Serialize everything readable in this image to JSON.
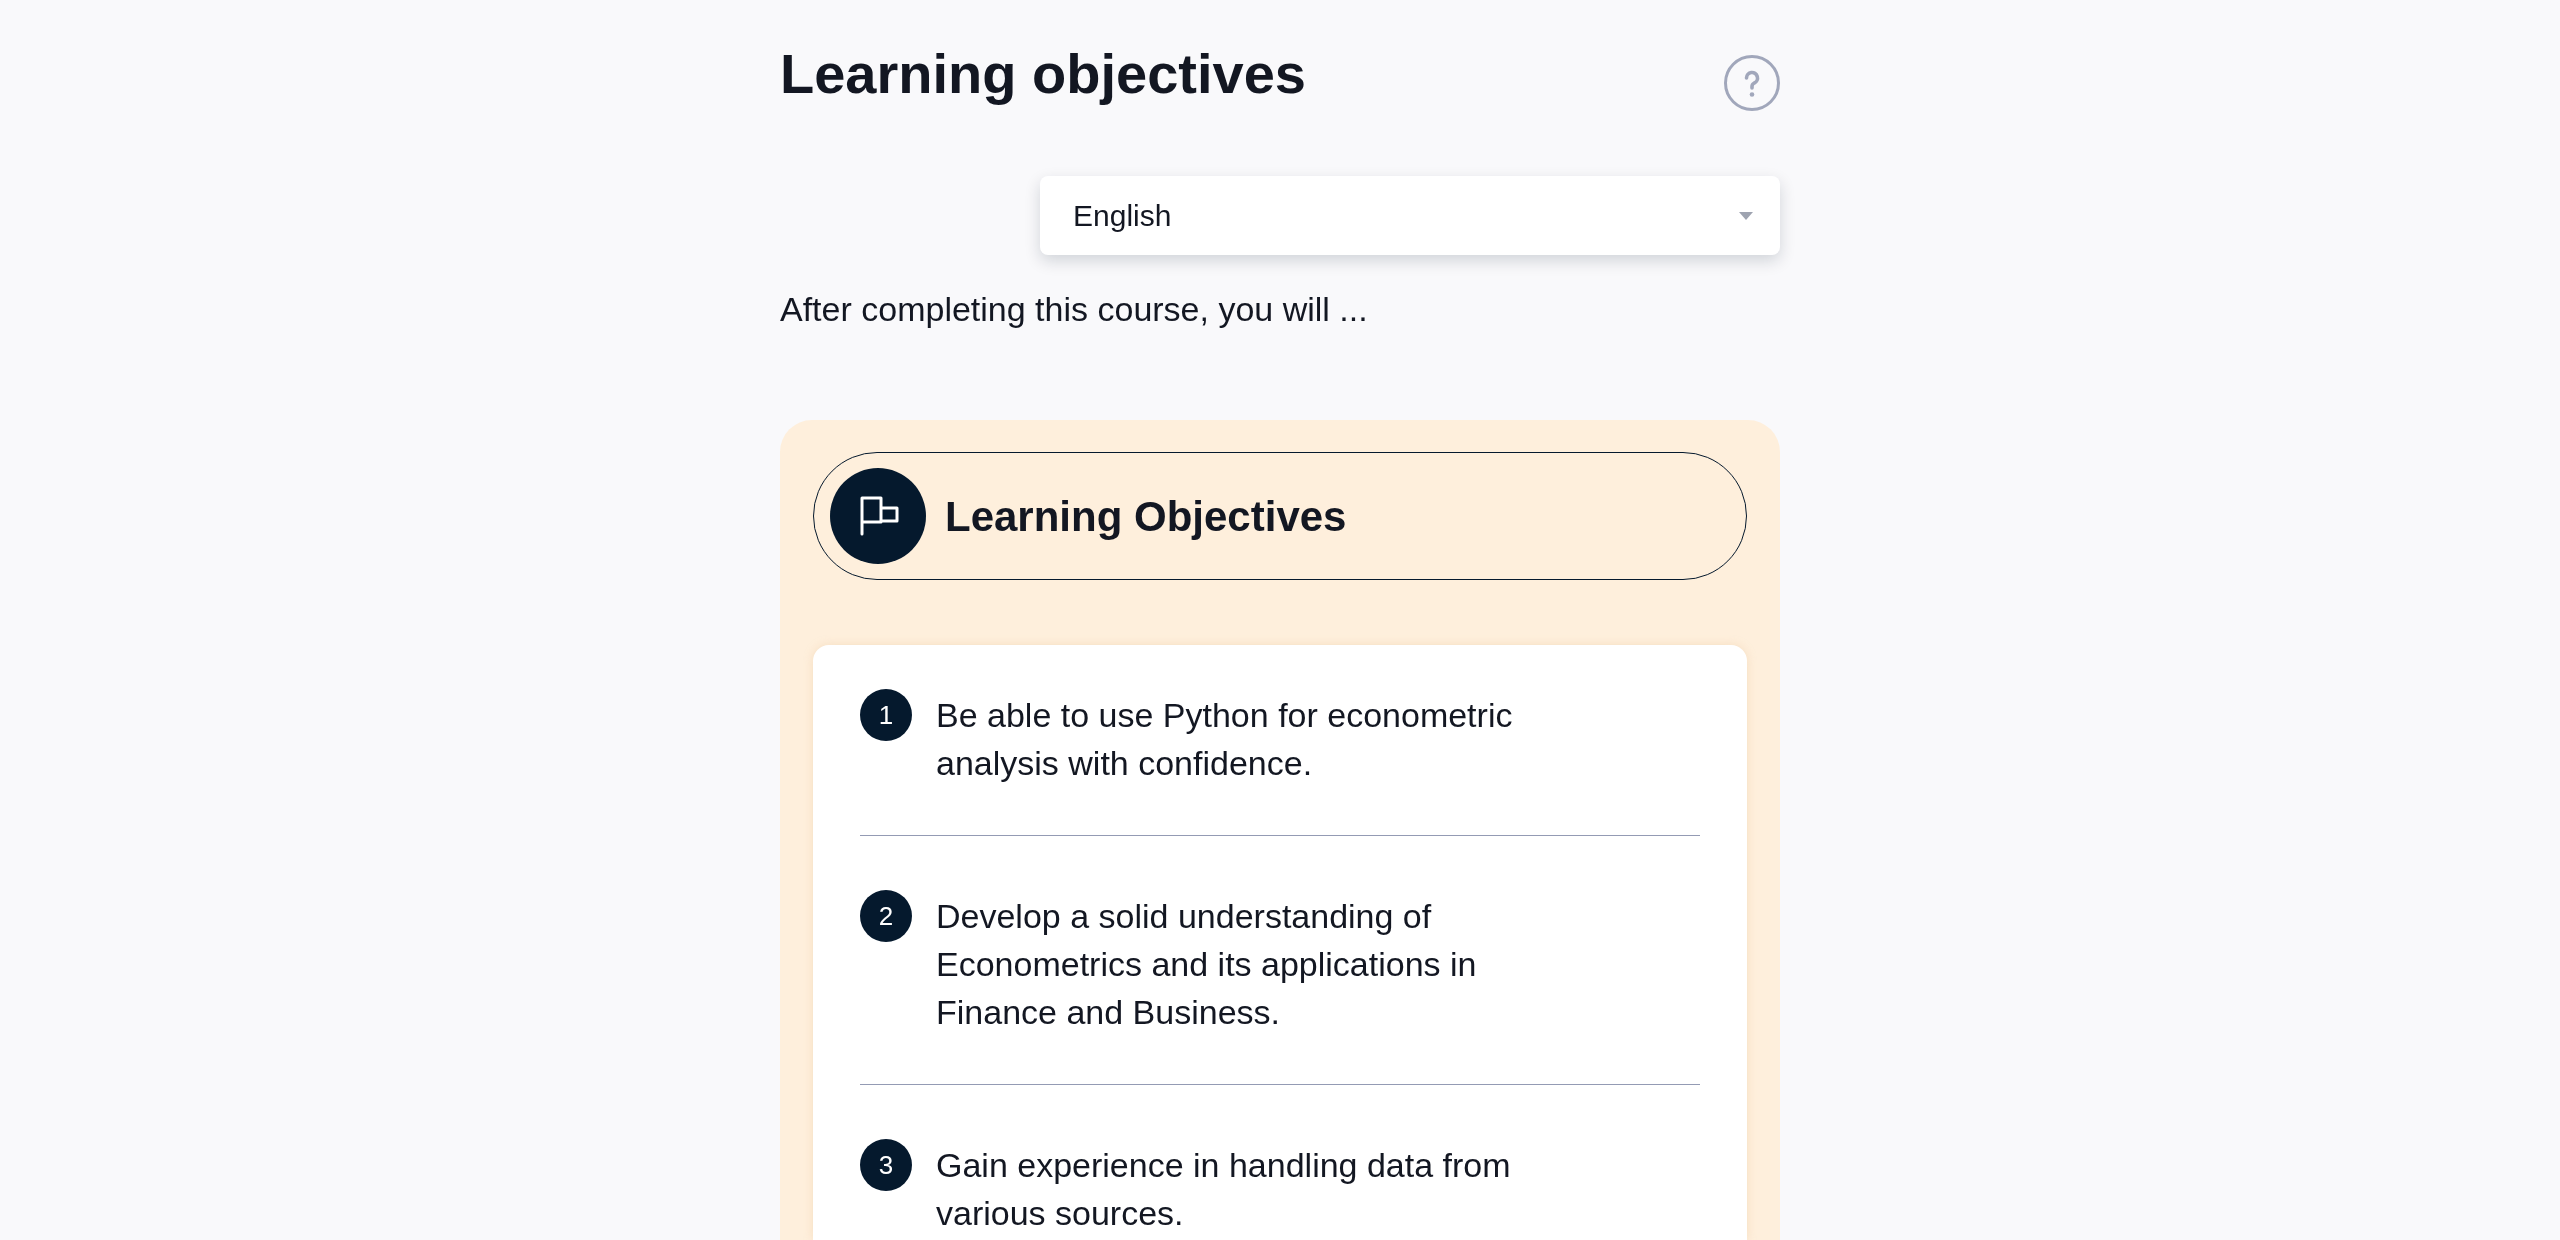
{
  "header": {
    "title": "Learning objectives"
  },
  "language_select": {
    "value": "English"
  },
  "intro": "After completing this course, you will ...",
  "objectives_card": {
    "title": "Learning Objectives",
    "items": [
      {
        "number": "1",
        "text": "Be able to use Python for econometric analysis with confidence."
      },
      {
        "number": "2",
        "text": "Develop a solid understanding of Econometrics and its applications in Finance and Business."
      },
      {
        "number": "3",
        "text": "Gain experience in handling data from various sources."
      }
    ]
  }
}
